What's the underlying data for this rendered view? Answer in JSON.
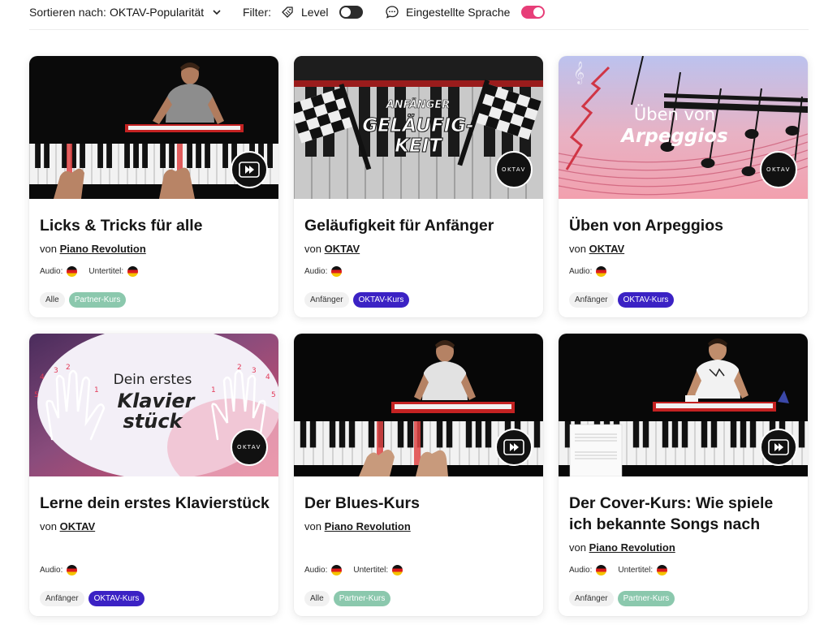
{
  "filters": {
    "sort_label": "Sortieren nach:",
    "sort_value": "OKTAV-Popularität",
    "filter_label": "Filter:",
    "level_label": "Level",
    "level_toggle_on": false,
    "language_label": "Eingestellte Sprache",
    "language_toggle_on": true
  },
  "colors": {
    "toggle_on": "#e73e78",
    "toggle_off": "#2c2c2c",
    "partner_tag": "#8bc8ad",
    "oktav_tag": "#3b22c4"
  },
  "courses": [
    {
      "title": "Licks & Tricks für alle",
      "author_prefix": "von",
      "author": "Piano Revolution",
      "audio_label": "Audio:",
      "subtitle_label": "Untertitel:",
      "level_tag": "Alle",
      "type_tag": "Partner-Kurs",
      "badge": "play-icon",
      "thumb": "pianist-dark"
    },
    {
      "title": "Geläufigkeit für Anfänger",
      "author_prefix": "von",
      "author": "OKTAV",
      "audio_label": "Audio:",
      "level_tag": "Anfänger",
      "type_tag": "OKTAV-Kurs",
      "thumb_line1": "ANFÄNGER",
      "thumb_line2": "GELÄUFIG-",
      "thumb_line3": "KEIT",
      "badge_text": "OKTAV",
      "thumb": "checkered-flags"
    },
    {
      "title": "Üben von Arpeggios",
      "author_prefix": "von",
      "author": "OKTAV",
      "audio_label": "Audio:",
      "level_tag": "Anfänger",
      "type_tag": "OKTAV-Kurs",
      "thumb_line1": "Üben von",
      "thumb_line2": "Arpeggios",
      "badge_text": "OKTAV",
      "thumb": "sheet-music"
    },
    {
      "title": "Lerne dein erstes Klavierstück",
      "author_prefix": "von",
      "author": "OKTAV",
      "audio_label": "Audio:",
      "level_tag": "Anfänger",
      "type_tag": "OKTAV-Kurs",
      "thumb_line1": "Dein erstes",
      "thumb_line2": "Klavier",
      "thumb_line3": "stück",
      "finger_numbers": [
        "5",
        "4",
        "3",
        "2",
        "1",
        "1",
        "2",
        "3",
        "4",
        "5"
      ],
      "badge_text": "OKTAV",
      "thumb": "hands"
    },
    {
      "title": "Der Blues-Kurs",
      "author_prefix": "von",
      "author": "Piano Revolution",
      "audio_label": "Audio:",
      "subtitle_label": "Untertitel:",
      "level_tag": "Alle",
      "type_tag": "Partner-Kurs",
      "badge": "play-icon",
      "thumb": "pianist-dark"
    },
    {
      "title": "Der Cover-Kurs: Wie spiele ich bekannte Songs nach",
      "author_prefix": "von",
      "author": "Piano Revolution",
      "audio_label": "Audio:",
      "subtitle_label": "Untertitel:",
      "level_tag": "Anfänger",
      "type_tag": "Partner-Kurs",
      "badge": "play-icon",
      "thumb": "pianist-dark"
    }
  ]
}
